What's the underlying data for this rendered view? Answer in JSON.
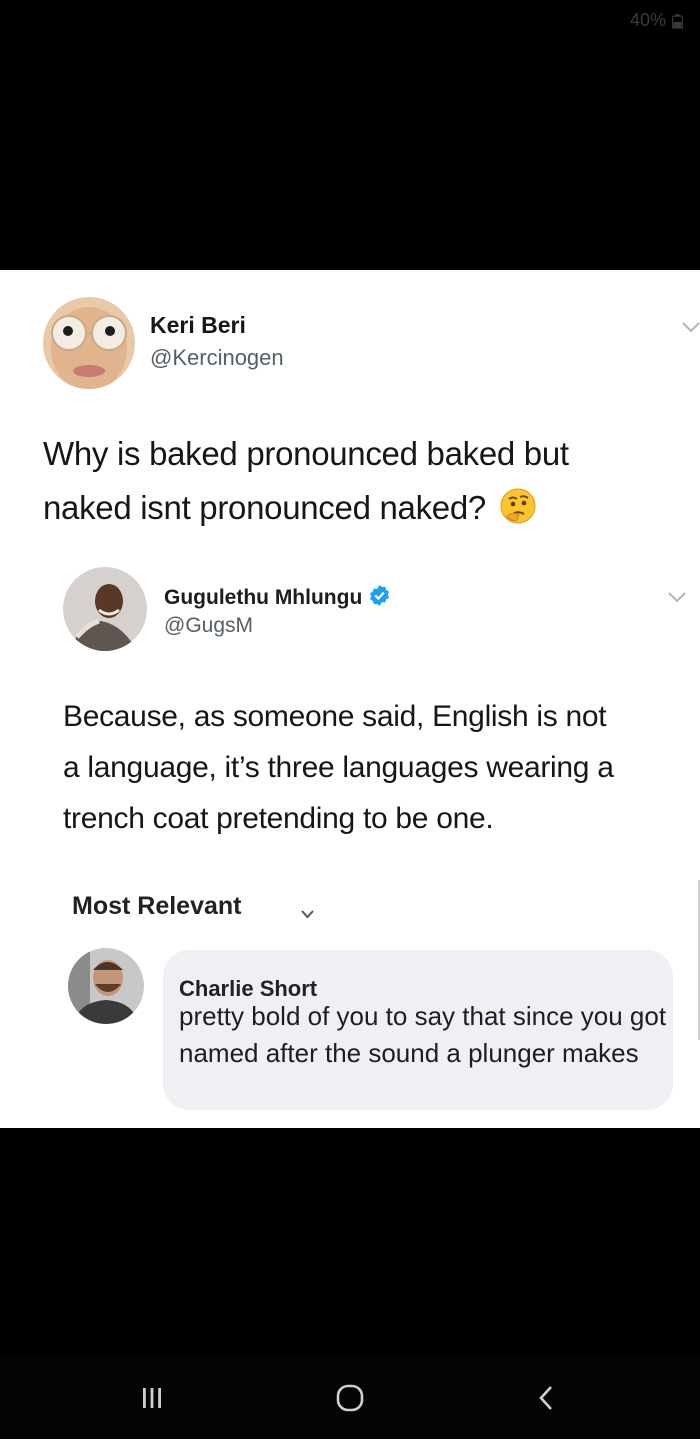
{
  "status_bar": {
    "battery": "40%"
  },
  "tweet": {
    "author_name": "Keri Beri",
    "author_handle": "@Kercinogen",
    "text_line1": "Why is baked pronounced baked but",
    "text_line2": "naked isnt pronounced naked?",
    "emoji": "thinking-face-icon"
  },
  "reply_tweet": {
    "author_name": "Gugulethu Mhlungu",
    "author_handle": "@GugsM",
    "text_line1": "Because, as someone said, English is not",
    "text_line2": "a language, it’s three languages wearing a",
    "text_line3": "trench coat pretending to be one."
  },
  "comments": {
    "sort_label": "Most Relevant",
    "items": [
      {
        "author": "Charlie Short",
        "text": "pretty bold of you to say that since you got named after the sound a plunger makes"
      }
    ]
  },
  "nav": {
    "recents": "recents-icon",
    "home": "home-icon",
    "back": "back-icon"
  },
  "colors": {
    "verified": "#1da1f2",
    "background": "#000000",
    "card": "#ffffff",
    "comment_bubble": "#eff0f3"
  }
}
